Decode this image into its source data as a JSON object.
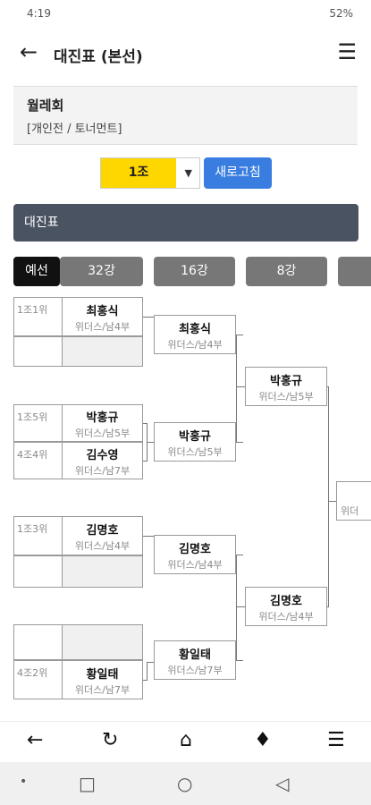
{
  "status": {
    "time": "4:19",
    "battery": "52%"
  },
  "header": {
    "title": "대진표 (본선)"
  },
  "event": {
    "name": "월레회",
    "type": "[개인전 / 토너먼트]"
  },
  "controls": {
    "group": "1조",
    "refresh": "새로고침"
  },
  "section": {
    "title": "대진표"
  },
  "tabs": [
    "예선",
    "32강",
    "16강",
    "8강"
  ],
  "bracket": {
    "r32": [
      {
        "rank": "1조1위",
        "name": "최홍식",
        "team": "위더스/남4부"
      },
      {
        "rank": "",
        "name": "",
        "team": ""
      },
      {
        "rank": "1조5위",
        "name": "박홍규",
        "team": "위더스/남5부"
      },
      {
        "rank": "4조4위",
        "name": "김수영",
        "team": "위더스/남7부"
      },
      {
        "rank": "1조3위",
        "name": "김명호",
        "team": "위더스/남4부"
      },
      {
        "rank": "",
        "name": "",
        "team": ""
      },
      {
        "rank": "",
        "name": "",
        "team": ""
      },
      {
        "rank": "4조2위",
        "name": "황일태",
        "team": "위더스/남7부"
      }
    ],
    "r16": [
      {
        "name": "최홍식",
        "team": "위더스/남4부"
      },
      {
        "name": "박홍규",
        "team": "위더스/남5부"
      },
      {
        "name": "김명호",
        "team": "위더스/남4부"
      },
      {
        "name": "황일태",
        "team": "위더스/남7부"
      }
    ],
    "r8": [
      {
        "name": "박홍규",
        "team": "위더스/남5부"
      },
      {
        "name": "김명호",
        "team": "위더스/남4부"
      }
    ],
    "r4": [
      {
        "name": "",
        "team": "위더"
      }
    ]
  },
  "icons": {
    "back": "arrow-left-icon",
    "menu": "hamburger-menu-icon",
    "refresh": "sync-icon",
    "home": "home-icon",
    "alarm": "bell-icon"
  }
}
